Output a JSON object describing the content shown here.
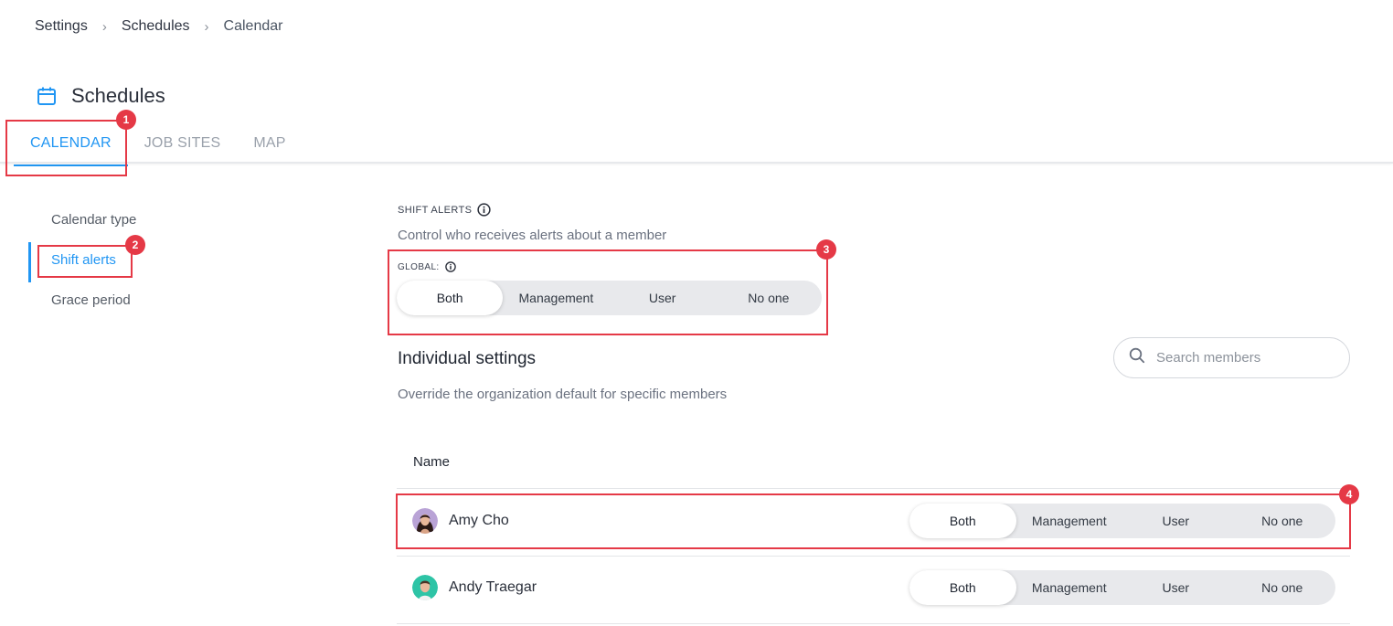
{
  "breadcrumb": [
    "Settings",
    "Schedules",
    "Calendar"
  ],
  "page_title": "Schedules",
  "tabs": [
    {
      "label": "CALENDAR",
      "active": true
    },
    {
      "label": "JOB SITES",
      "active": false
    },
    {
      "label": "MAP",
      "active": false
    }
  ],
  "side_nav": [
    {
      "label": "Calendar type",
      "active": false
    },
    {
      "label": "Shift alerts",
      "active": true
    },
    {
      "label": "Grace period",
      "active": false
    }
  ],
  "shift_alerts": {
    "label": "SHIFT ALERTS",
    "description": "Control who receives alerts about a member",
    "global_label": "GLOBAL:",
    "options": [
      "Both",
      "Management",
      "User",
      "No one"
    ],
    "selected": "Both"
  },
  "individual": {
    "title": "Individual settings",
    "description": "Override the organization default for specific members",
    "search_placeholder": "Search members",
    "column_name": "Name",
    "members": [
      {
        "name": "Amy Cho",
        "selected": "Both"
      },
      {
        "name": "Andy Traegar",
        "selected": "Both"
      }
    ]
  },
  "annotations": [
    "1",
    "2",
    "3",
    "4"
  ],
  "colors": {
    "accent": "#2196f3",
    "annotation": "#e53946",
    "segment_bg": "#e8e9ec"
  }
}
